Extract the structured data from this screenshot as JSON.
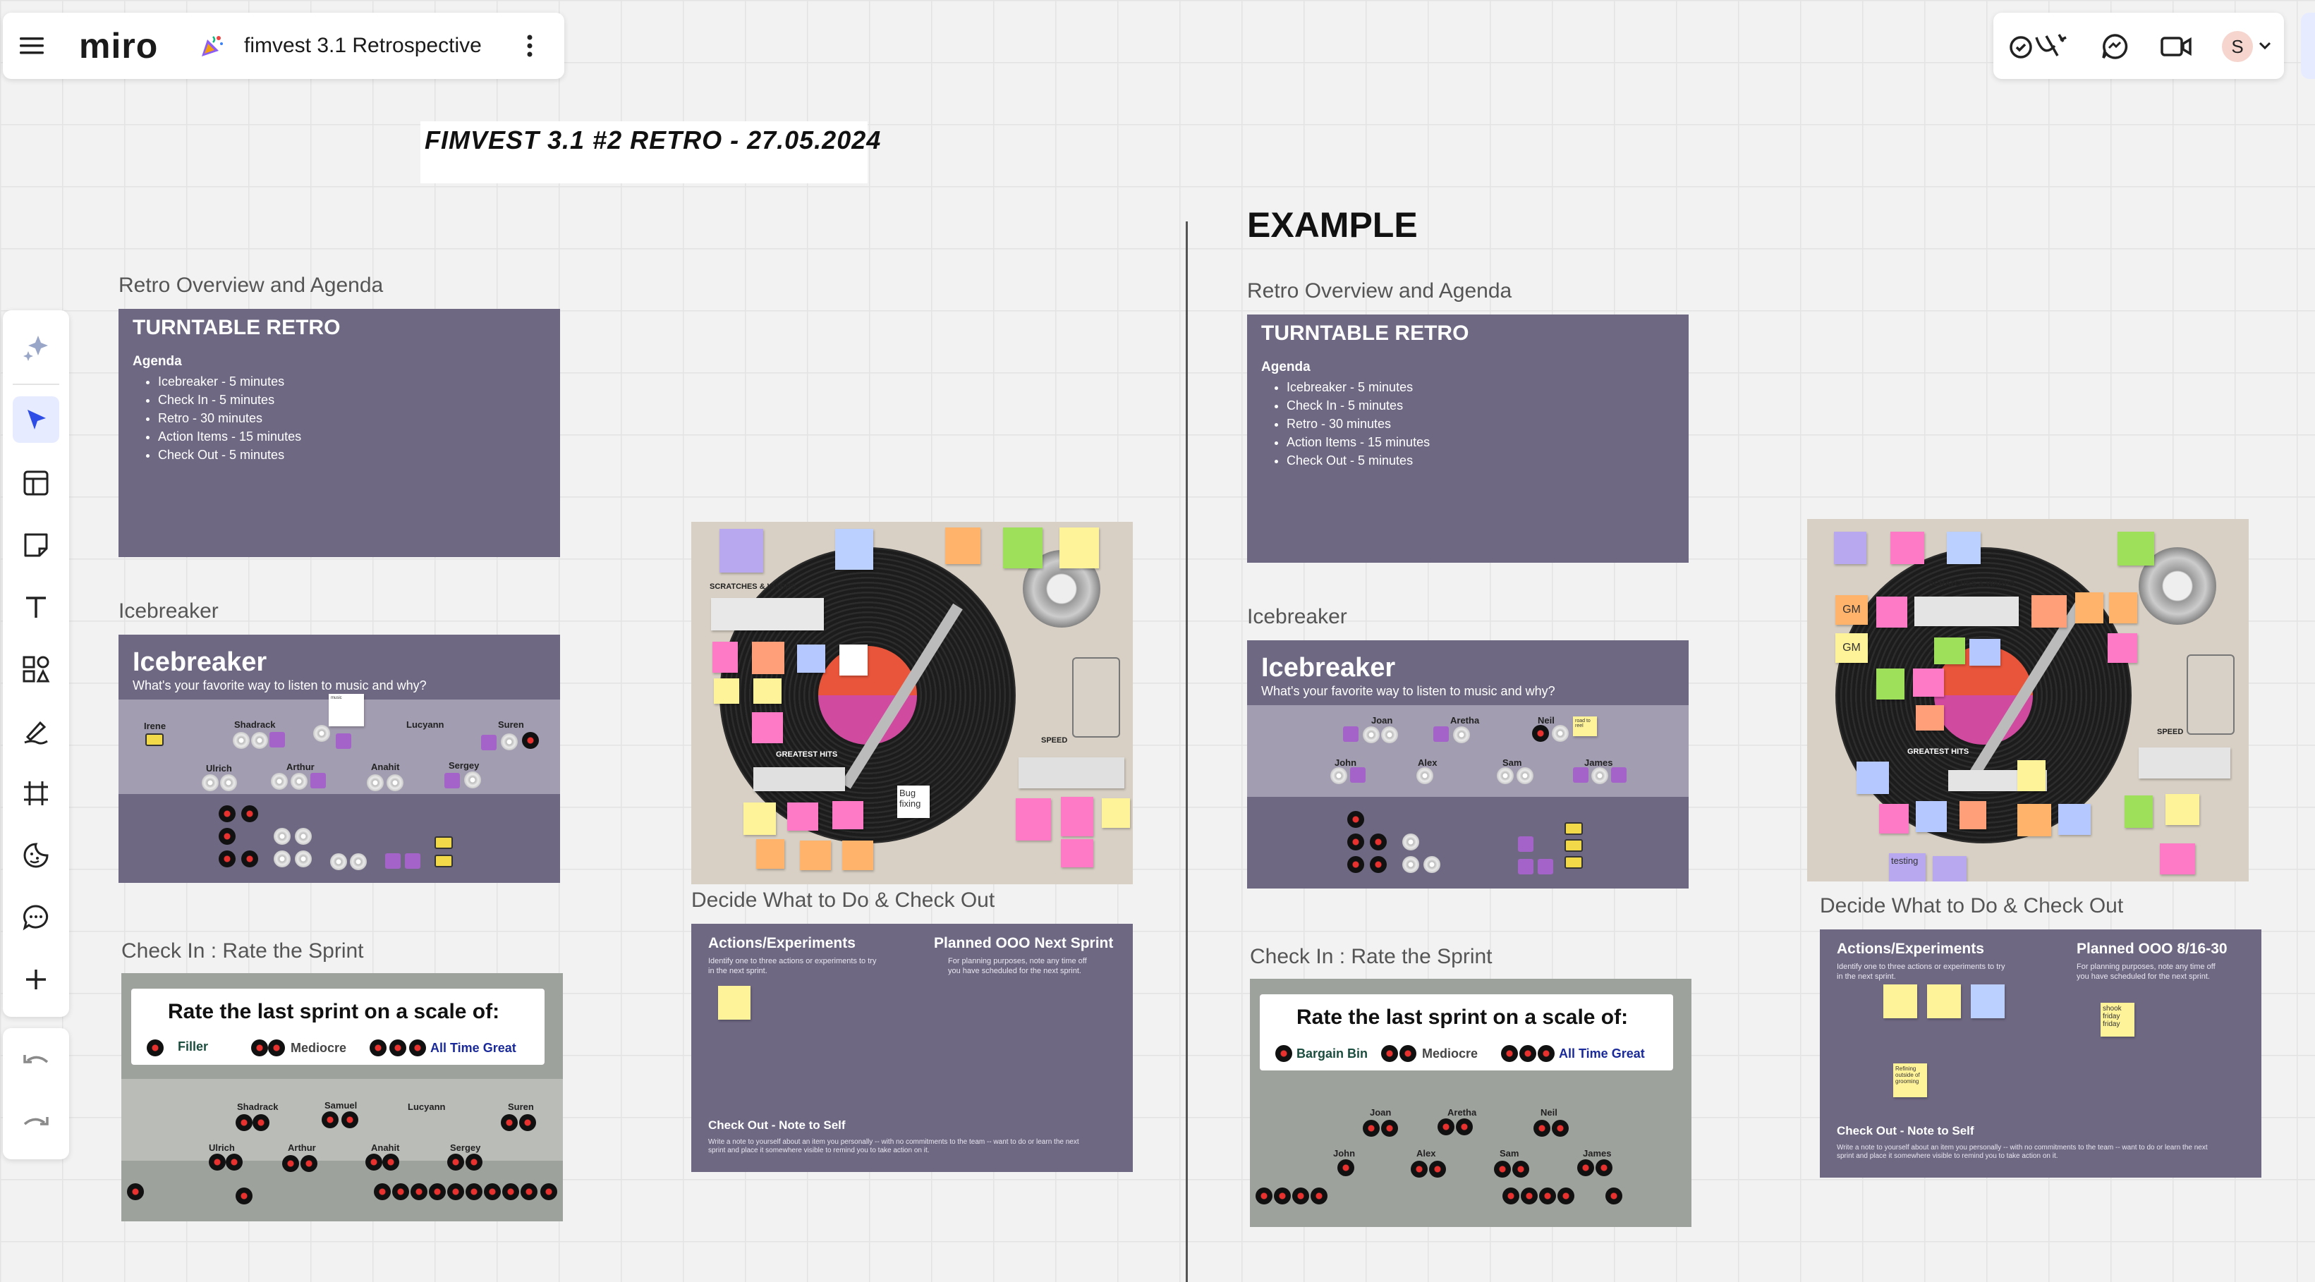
{
  "topbar": {
    "logo": "miro",
    "board_title": "fimvest 3.1 Retrospective",
    "avatar_initial": "S"
  },
  "board": {
    "heading": "FIMVEST 3.1 #2 RETRO - 27.05.2024",
    "example_heading": "EXAMPLE"
  },
  "left_frames": {
    "overview_label": "Retro Overview and Agenda",
    "icebreaker_label": "Icebreaker",
    "checkin_label": "Check In : Rate the Sprint",
    "decide_label": "Decide What to Do & Check Out"
  },
  "right_frames": {
    "overview_label": "Retro Overview and Agenda",
    "icebreaker_label": "Icebreaker",
    "checkin_label": "Check In : Rate the Sprint",
    "decide_label": "Decide What to Do & Check Out"
  },
  "turntable_retro": {
    "title": "TURNTABLE RETRO",
    "agenda_heading": "Agenda",
    "items": [
      "Icebreaker - 5 minutes",
      "Check In - 5 minutes",
      "Retro - 30 minutes",
      "Action Items - 15 minutes",
      "Check Out - 5 minutes"
    ]
  },
  "icebreaker": {
    "title": "Icebreaker",
    "question": "What's your favorite way to listen to music and why?",
    "left_names": [
      "Irene",
      "Shadrack",
      "Lucyann",
      "Suren",
      "Ulrich",
      "Arthur",
      "Anahit",
      "Sergey"
    ],
    "right_names": [
      "Joan",
      "Aretha",
      "Neil",
      "John",
      "Alex",
      "Sam",
      "James"
    ]
  },
  "rate": {
    "title": "Rate the last sprint on a scale of:",
    "left_labels": [
      "Filler",
      "Mediocre",
      "All Time Great"
    ],
    "right_labels": [
      "Bargain Bin",
      "Mediocre",
      "All Time Great"
    ],
    "left_names": [
      "Shadrack",
      "Samuel",
      "Lucyann",
      "Suren",
      "Ulrich",
      "Arthur",
      "Anahit",
      "Sergey"
    ],
    "right_names": [
      "Joan",
      "Aretha",
      "Neil",
      "John",
      "Alex",
      "Sam",
      "James"
    ]
  },
  "turntable_board": {
    "scratches": "SCRATCHES & WARPS",
    "greatest": "GREATEST HITS",
    "speed": "SPEED",
    "bug_note": "Bug fixing",
    "gm": "GM",
    "testing": "testing"
  },
  "decide": {
    "actions_title": "Actions/Experiments",
    "actions_text": "Identify one to three actions or experiments to try in the next sprint.",
    "planned_left": "Planned OOO Next Sprint",
    "planned_right": "Planned OOO 8/16-30",
    "planned_text": "For planning purposes, note any time off you have scheduled for the next sprint.",
    "checkout_title": "Check Out - Note to Self",
    "checkout_text": "Write a note to yourself about an item you personally -- with no commitments to the team -- want to do or learn the next sprint and place it somewhere visible to remind you to take action on it.",
    "sticky_a": "Refining outside of grooming",
    "sticky_b": "shook friday friday"
  },
  "colors": {
    "purple": "#6f6883",
    "accent": "#4262ff"
  }
}
